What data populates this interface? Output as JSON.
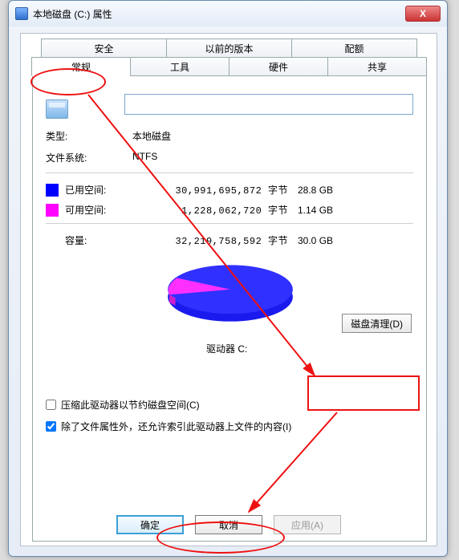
{
  "window": {
    "title": "本地磁盘 (C:) 属性",
    "close_x": "X"
  },
  "tabs_top": [
    "安全",
    "以前的版本",
    "配额"
  ],
  "tabs_bot": [
    "常规",
    "工具",
    "硬件",
    "共享"
  ],
  "active_tab": "常规",
  "drive": {
    "name_value": "",
    "type_label": "类型:",
    "type_value": "本地磁盘",
    "fs_label": "文件系统:",
    "fs_value": "NTFS"
  },
  "space": {
    "used": {
      "label": "已用空间:",
      "bytes": "30,991,695,872 字节",
      "human": "28.8 GB",
      "color": "#0000ff"
    },
    "free": {
      "label": "可用空间:",
      "bytes": "1,228,062,720 字节",
      "human": "1.14 GB",
      "color": "#ff00ff"
    },
    "cap": {
      "label": "容量:",
      "bytes": "32,219,758,592 字节",
      "human": "30.0 GB"
    }
  },
  "drive_letter_label": "驱动器 C:",
  "cleanup_button": "磁盘清理(D)",
  "checks": {
    "compress": {
      "label": "压缩此驱动器以节约磁盘空间(C)",
      "checked": false
    },
    "index": {
      "label": "除了文件属性外，还允许索引此驱动器上文件的内容(I)",
      "checked": true
    }
  },
  "buttons": {
    "ok": "确定",
    "cancel": "取消",
    "apply": "应用(A)"
  },
  "chart_data": {
    "type": "pie",
    "title": "",
    "series": [
      {
        "name": "已用空间",
        "value": 28.8,
        "unit": "GB",
        "color": "#0000ff"
      },
      {
        "name": "可用空间",
        "value": 1.14,
        "unit": "GB",
        "color": "#ff00ff"
      }
    ]
  }
}
